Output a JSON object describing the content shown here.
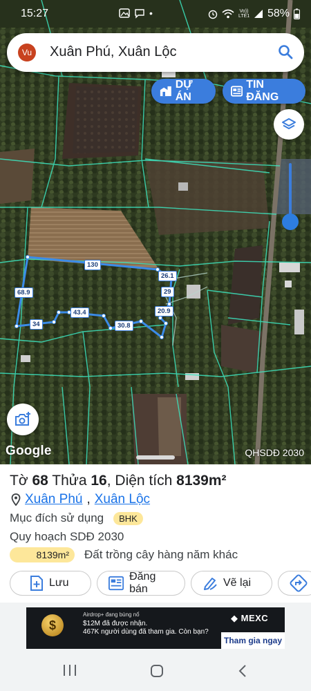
{
  "status_bar": {
    "time": "15:27",
    "carrier": "Vo)) LTE1",
    "battery": "58%"
  },
  "search": {
    "avatar_initials": "Vu",
    "query": "Xuân Phú, Xuân Lộc"
  },
  "map_buttons": {
    "du_an": "DỰ ÁN",
    "tin_dang": "TIN ĐĂNG"
  },
  "map": {
    "google_logo": "Google",
    "plan_label": "QHSDĐ 2030",
    "edge_labels": {
      "top": "130",
      "top_right": "26.1",
      "right_1": "29",
      "right_2": "20.9",
      "bottom_mid": "30.8",
      "bottom_left": "43.4",
      "left_bottom": "34",
      "left": "68.9"
    }
  },
  "parcel": {
    "to_label": "Tờ",
    "to_value": "68",
    "thua_label": "Thửa",
    "thua_value": "16",
    "area_label": "Diện tích",
    "area_value": "8139m²",
    "commune": "Xuân Phú",
    "district": "Xuân Lộc",
    "purpose_label": "Mục đích sử dụng",
    "purpose_code": "BHK",
    "plan": "Quy hoạch SDĐ 2030",
    "plan_area": "8139m²",
    "plan_desc": "Đất trồng cây hàng năm khác"
  },
  "actions": {
    "save": "Lưu",
    "sell": "Đăng bán",
    "redraw": "Vẽ lại"
  },
  "ad": {
    "line1": "Airdrop+ đang bùng nổ",
    "line2": "$12M đã được nhận.",
    "line3": "467K người dùng đã tham gia. Còn bạn?",
    "brand": "MEXC",
    "cta": "Tham gia ngay"
  },
  "colors": {
    "accent": "#3b7ddd",
    "badge": "#fde79a",
    "parcel_line": "#3b8be8"
  }
}
